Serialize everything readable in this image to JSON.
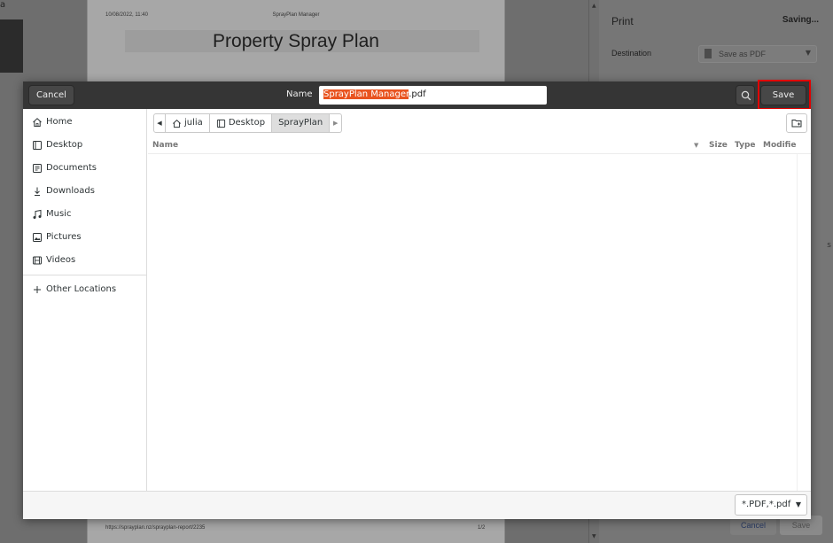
{
  "background": {
    "left_edge_glyph": "a",
    "preview": {
      "date": "10/08/2022, 11:40",
      "app_name": "SprayPlan Manager",
      "title": "Property Spray Plan",
      "url": "https://sprayplan.nz/sprayplan-report/2235",
      "page_number": "1/2"
    },
    "print_panel": {
      "heading": "Print",
      "status": "Saving...",
      "destination_label": "Destination",
      "destination_value": "Save as PDF",
      "cancel_label": "Cancel",
      "save_label": "Save",
      "edge_glyph": "s"
    }
  },
  "dialog": {
    "header": {
      "cancel_label": "Cancel",
      "name_label": "Name",
      "filename_selected": "SprayPlan Manager",
      "filename_rest": ".pdf",
      "save_label": "Save"
    },
    "sidebar": {
      "items": [
        {
          "label": "Home",
          "icon": "home-icon"
        },
        {
          "label": "Desktop",
          "icon": "desktop-icon"
        },
        {
          "label": "Documents",
          "icon": "documents-icon"
        },
        {
          "label": "Downloads",
          "icon": "downloads-icon"
        },
        {
          "label": "Music",
          "icon": "music-icon"
        },
        {
          "label": "Pictures",
          "icon": "pictures-icon"
        },
        {
          "label": "Videos",
          "icon": "videos-icon"
        }
      ],
      "other_locations": "Other Locations"
    },
    "pathbar": {
      "segments": [
        "julia",
        "Desktop",
        "SprayPlan"
      ]
    },
    "columns": {
      "name": "Name",
      "size": "Size",
      "type": "Type",
      "modified": "Modified"
    },
    "footer": {
      "filter_value": "*.PDF,*.pdf"
    }
  },
  "colors": {
    "selection": "#e95420",
    "highlight": "#e10000",
    "headerbar": "#353535"
  }
}
